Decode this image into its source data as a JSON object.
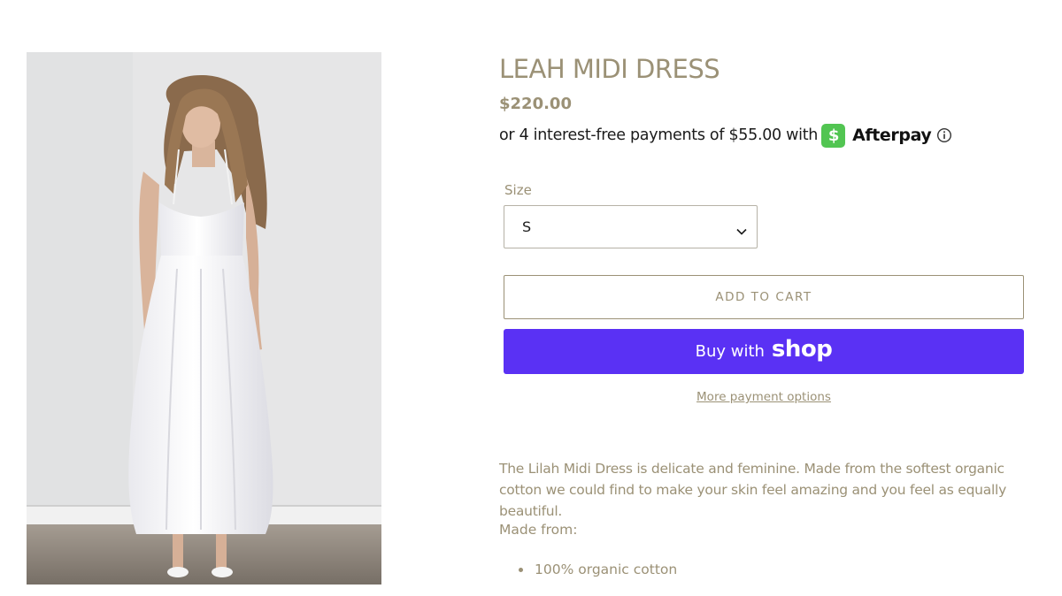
{
  "product": {
    "title": "LEAH MIDI DRESS",
    "price": "$220.00",
    "image_alt": "Model wearing white halter midi dress"
  },
  "afterpay": {
    "text": "or 4 interest-free payments of $55.00 with",
    "brand": "Afterpay",
    "badge_color": "#52c552",
    "info_icon": "info-circle-icon"
  },
  "size": {
    "label": "Size",
    "selected": "S"
  },
  "buttons": {
    "add_to_cart": "ADD TO CART",
    "buy_prefix": "Buy with",
    "buy_brand": "shop",
    "buy_color": "#5a31f4",
    "more_options": "More payment options"
  },
  "description": {
    "text": "The Lilah Midi Dress is delicate and feminine. Made from the softest organic cotton we could find to make your skin feel amazing and you feel as equally beautiful.",
    "made_from_label": "Made from:",
    "materials": [
      "100% organic cotton"
    ]
  },
  "colors": {
    "accent": "#9b9176",
    "text": "#1b1b1b"
  }
}
